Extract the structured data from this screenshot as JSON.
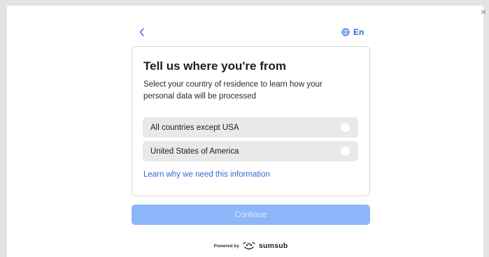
{
  "header": {
    "close_label": "×",
    "back_icon": "chevron-left-icon",
    "language_icon": "globe-icon",
    "language_label": "En"
  },
  "card": {
    "title": "Tell us where you're from",
    "description": "Select your country of residence to learn how your personal data will be processed",
    "options": [
      {
        "label": "All countries except USA",
        "selected": false
      },
      {
        "label": "United States of America",
        "selected": false
      }
    ],
    "learn_link": "Learn why we need this information"
  },
  "actions": {
    "continue_label": "Continue",
    "continue_enabled": false
  },
  "footer": {
    "powered_by": "Powered by",
    "brand": "sumsub",
    "brand_icon": "sumsub-logo-icon"
  },
  "colors": {
    "accent": "#2f6bd8",
    "button_disabled": "#8db5f9",
    "option_bg": "#e9e9e9",
    "page_bg": "#e4e4e4"
  }
}
